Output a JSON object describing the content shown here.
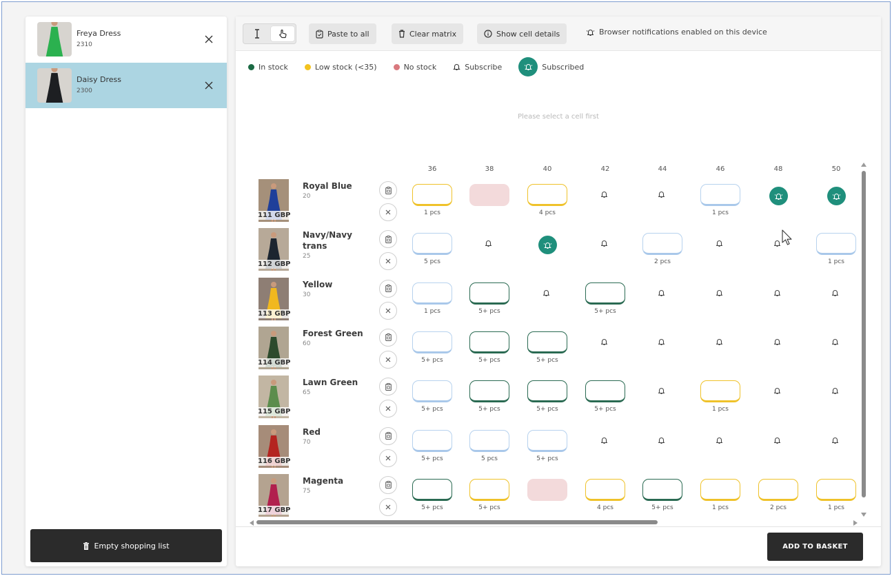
{
  "shopping_list": {
    "items": [
      {
        "name": "Freya Dress",
        "code": "2310",
        "active": false,
        "color": "#2bb14f"
      },
      {
        "name": "Daisy Dress",
        "code": "2300",
        "active": true,
        "color": "#1d1f22"
      }
    ],
    "empty_button": "Empty shopping list"
  },
  "toolbar": {
    "paste_label": "Paste to all",
    "clear_label": "Clear matrix",
    "details_label": "Show cell details",
    "notification_note": "Browser notifications enabled on this device"
  },
  "legend": {
    "in_stock": "In stock",
    "low_stock": "Low stock (<35)",
    "no_stock": "No stock",
    "subscribe": "Subscribe",
    "subscribed": "Subscribed"
  },
  "colors": {
    "in_stock": "#1b6a44",
    "low_stock": "#f3c31f",
    "no_stock": "#d9797e",
    "subscribed": "#1f8f7c"
  },
  "hint": "Please select a cell first",
  "sizes": [
    "36",
    "38",
    "40",
    "42",
    "44",
    "46",
    "48",
    "50"
  ],
  "rows": [
    {
      "name": "Royal Blue",
      "code": "20",
      "price": "111 GBP",
      "dress": "#1f3f9a",
      "bg": "#a5907a",
      "cells": [
        [
          "yellow",
          "1 pcs"
        ],
        [
          "nostock",
          ""
        ],
        [
          "yellow",
          "4 pcs"
        ],
        [
          "bell",
          ""
        ],
        [
          "bell",
          ""
        ],
        [
          "blue",
          "1 pcs"
        ],
        [
          "sub",
          ""
        ],
        [
          "sub",
          ""
        ]
      ]
    },
    {
      "name": "Navy/Navy trans",
      "code": "25",
      "price": "112 GBP",
      "dress": "#1c2530",
      "bg": "#b7a998",
      "cells": [
        [
          "blue",
          "5 pcs"
        ],
        [
          "bell",
          ""
        ],
        [
          "sub",
          ""
        ],
        [
          "bell",
          ""
        ],
        [
          "blue",
          "2 pcs"
        ],
        [
          "bell",
          ""
        ],
        [
          "bell",
          ""
        ],
        [
          "blue",
          "1 pcs"
        ]
      ]
    },
    {
      "name": "Yellow",
      "code": "30",
      "price": "113 GBP",
      "dress": "#f1b81f",
      "bg": "#8e7e74",
      "cells": [
        [
          "blue",
          "1 pcs"
        ],
        [
          "green",
          "5+ pcs"
        ],
        [
          "bell",
          ""
        ],
        [
          "green",
          "5+ pcs"
        ],
        [
          "bell",
          ""
        ],
        [
          "bell",
          ""
        ],
        [
          "bell",
          ""
        ],
        [
          "bell",
          ""
        ]
      ]
    },
    {
      "name": "Forest Green",
      "code": "60",
      "price": "114 GBP",
      "dress": "#2c4a2c",
      "bg": "#b0a592",
      "cells": [
        [
          "blue",
          "5+ pcs"
        ],
        [
          "green",
          "5+ pcs"
        ],
        [
          "green",
          "5+ pcs"
        ],
        [
          "bell",
          ""
        ],
        [
          "bell",
          ""
        ],
        [
          "bell",
          ""
        ],
        [
          "bell",
          ""
        ],
        [
          "bell",
          ""
        ]
      ]
    },
    {
      "name": "Lawn Green",
      "code": "65",
      "price": "115 GBP",
      "dress": "#5c8d4d",
      "bg": "#c2b6a3",
      "cells": [
        [
          "blue",
          "5+ pcs"
        ],
        [
          "green",
          "5+ pcs"
        ],
        [
          "green",
          "5+ pcs"
        ],
        [
          "green",
          "5+ pcs"
        ],
        [
          "bell",
          ""
        ],
        [
          "yellow",
          "1 pcs"
        ],
        [
          "bell",
          ""
        ],
        [
          "bell",
          ""
        ]
      ]
    },
    {
      "name": "Red",
      "code": "70",
      "price": "116 GBP",
      "dress": "#b42420",
      "bg": "#a68c79",
      "cells": [
        [
          "blue",
          "5+ pcs"
        ],
        [
          "blue",
          "5 pcs"
        ],
        [
          "blue",
          "5+ pcs"
        ],
        [
          "bell",
          ""
        ],
        [
          "bell",
          ""
        ],
        [
          "bell",
          ""
        ],
        [
          "bell",
          ""
        ],
        [
          "bell",
          ""
        ]
      ]
    },
    {
      "name": "Magenta",
      "code": "75",
      "price": "117 GBP",
      "dress": "#b1204e",
      "bg": "#b4a390",
      "cells": [
        [
          "green",
          "5+ pcs"
        ],
        [
          "yellow",
          "5+ pcs"
        ],
        [
          "nostock",
          ""
        ],
        [
          "yellow",
          "4 pcs"
        ],
        [
          "green",
          "5+ pcs"
        ],
        [
          "yellow",
          "1 pcs"
        ],
        [
          "yellow",
          "2 pcs"
        ],
        [
          "yellow",
          "1 pcs"
        ]
      ]
    }
  ],
  "basket_button": "ADD TO BASKET"
}
